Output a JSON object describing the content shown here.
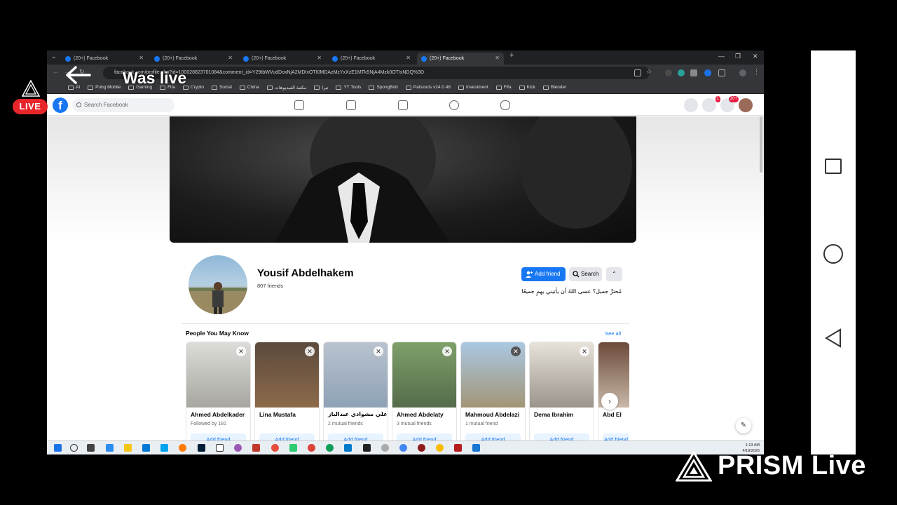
{
  "overlay": {
    "live_badge": "LIVE",
    "was_live": "Was live",
    "prism_brand": "PRISM Live"
  },
  "browser": {
    "tabs": [
      {
        "label": "(20+) Facebook",
        "active": false
      },
      {
        "label": "(20+) Facebook",
        "active": false
      },
      {
        "label": "(20+) Facebook",
        "active": false
      },
      {
        "label": "(20+) Facebook",
        "active": false
      },
      {
        "label": "(20+) Facebook",
        "active": true
      }
    ],
    "new_tab": "+",
    "url": "facebook.com/profile.php?id=100028823701084&comment_id=Y29tbWVudDoxNjA2MDIxOTI0MDAzMzYxXzE1MTk5NjA4Mzk0OTIxNDQ%3D",
    "bookmarks": [
      "AI",
      "Pubg Mobile",
      "Gaming",
      "Fifa",
      "Crypto",
      "Social",
      "China",
      "مكتبة الفيديوهات",
      "تيرا",
      "YT Tools",
      "SpongBob",
      "Palstools v24.0.48",
      "Investment",
      "Fifa",
      "Kick",
      "Blender"
    ]
  },
  "facebook": {
    "logo": "f",
    "search_placeholder": "Search Facebook",
    "messenger_badge": "1",
    "notifications_badge": "20+",
    "profile": {
      "name": "Yousif Abdelhakem",
      "friends": "807 friends",
      "bio": "مُحترِّ جميل؟ عسى اللهُ أن يأتيني بهمِ جميعًا",
      "add_friend": "Add friend",
      "search": "Search",
      "more": "⌃"
    },
    "pymk": {
      "title": "People You May Know",
      "see_all": "See all",
      "cards": [
        {
          "name": "Ahmed Abdelkader",
          "sub": "Followed by 181",
          "button": "Add friend"
        },
        {
          "name": "Lina Mustafa",
          "sub": "",
          "button": "Add friend"
        },
        {
          "name": "علي مشوادي عبدالباز",
          "sub": "2 mutual friends",
          "button": "Add friend"
        },
        {
          "name": "Ahmed Abdelaty",
          "sub": "3 mutual friends",
          "button": "Add friend"
        },
        {
          "name": "Mahmoud Abdelazi",
          "sub": "1 mutual friend",
          "button": "Add friend"
        },
        {
          "name": "Dema Ibrahim",
          "sub": "",
          "button": "Add friend"
        },
        {
          "name": "Abd El",
          "sub": "",
          "button": "Add friend"
        }
      ]
    }
  },
  "taskbar": {
    "time": "1:13 AM",
    "date": "4/18/2026"
  }
}
